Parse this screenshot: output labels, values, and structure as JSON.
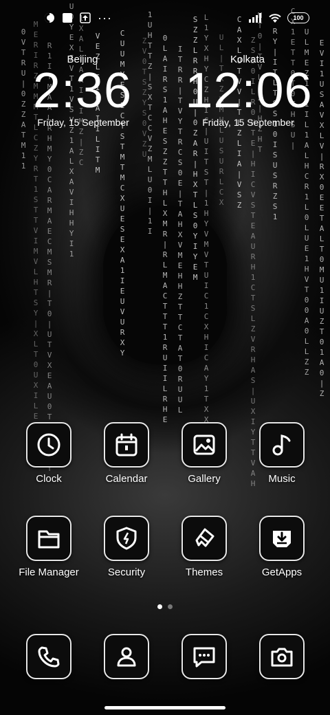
{
  "status_bar": {
    "battery": "100",
    "left_icons": [
      "theme-icon",
      "square-icon",
      "upload-icon",
      "more-dots-icon"
    ],
    "right_icons": [
      "signal-icon",
      "wifi-icon",
      "battery-icon"
    ]
  },
  "clocks": [
    {
      "city": "Beijing",
      "time": "2:36",
      "date": "Friday, 15 September"
    },
    {
      "city": "Kolkata",
      "time": "12:06",
      "date": "Friday, 15 September"
    }
  ],
  "apps": [
    {
      "label": "Clock",
      "icon": "clock-icon"
    },
    {
      "label": "Calendar",
      "icon": "calendar-icon"
    },
    {
      "label": "Gallery",
      "icon": "gallery-icon"
    },
    {
      "label": "Music",
      "icon": "music-icon"
    },
    {
      "label": "File Manager",
      "icon": "folder-icon"
    },
    {
      "label": "Security",
      "icon": "shield-icon"
    },
    {
      "label": "Themes",
      "icon": "brush-icon"
    },
    {
      "label": "GetApps",
      "icon": "download-icon"
    }
  ],
  "dock": [
    {
      "icon": "phone-icon"
    },
    {
      "icon": "contacts-icon"
    },
    {
      "icon": "messages-icon"
    },
    {
      "icon": "camera-icon"
    }
  ],
  "page_indicator": {
    "pages": 2,
    "current": 1
  },
  "colors": {
    "icon_border": "#e8e8e8",
    "icon_bg": "#0c0c0c",
    "text": "#ffffff"
  }
}
